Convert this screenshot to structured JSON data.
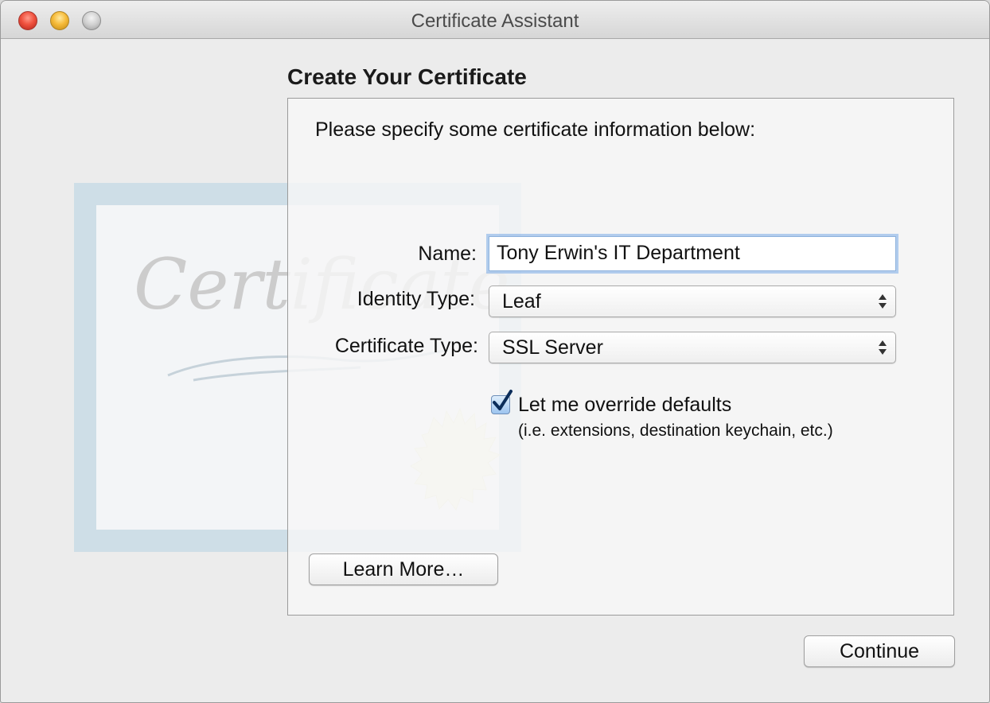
{
  "window": {
    "title": "Certificate Assistant"
  },
  "artwork": {
    "watermark_text": "Certificate"
  },
  "page": {
    "heading": "Create Your Certificate",
    "instruction": "Please specify some certificate information below:"
  },
  "form": {
    "name_label": "Name:",
    "name_value": "Tony Erwin's IT Department",
    "identity_type_label": "Identity Type:",
    "identity_type_value": "Leaf",
    "certificate_type_label": "Certificate Type:",
    "certificate_type_value": "SSL Server",
    "override_checkbox_label": "Let me override defaults",
    "override_checkbox_sublabel": "(i.e. extensions, destination keychain, etc.)",
    "override_checked": true
  },
  "buttons": {
    "learn_more": "Learn More…",
    "continue": "Continue"
  },
  "colors": {
    "focus_ring": "#78aae6",
    "close": "#f0523f",
    "minimize": "#f6bb3a",
    "zoom": "#cfcfcf",
    "check": "#0b2d5a"
  }
}
